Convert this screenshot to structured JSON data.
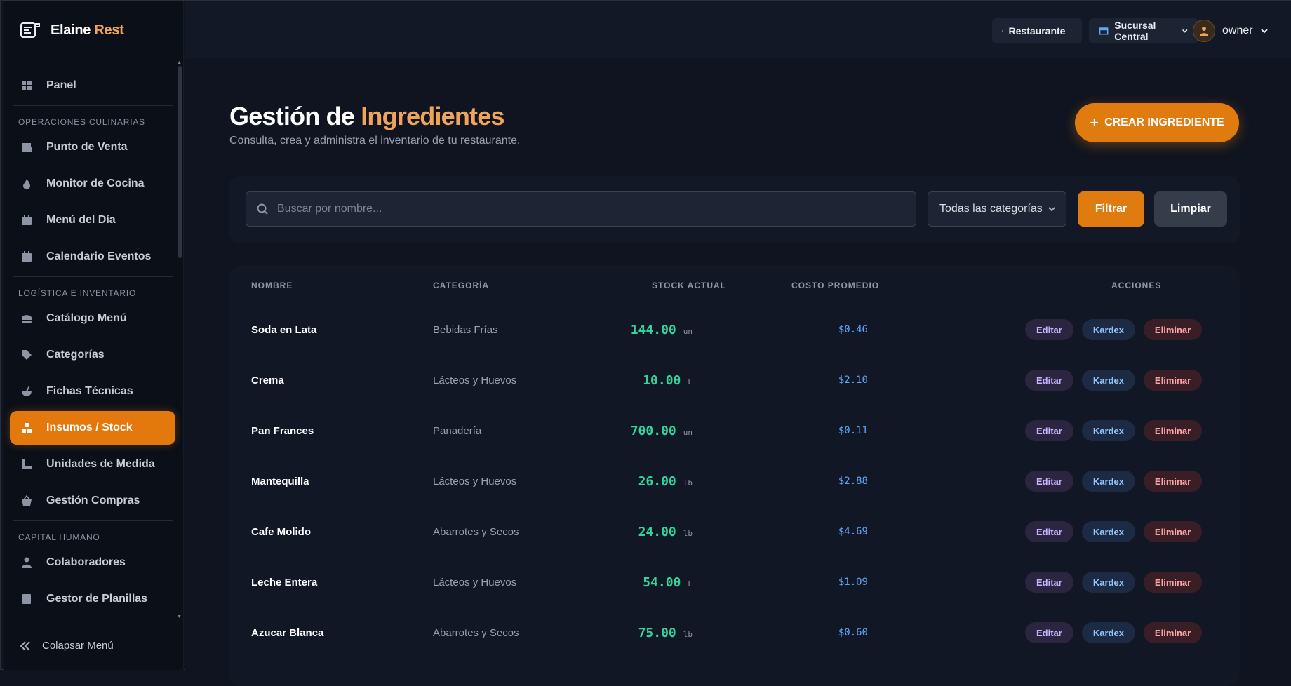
{
  "app": {
    "brand_main": "Elaine",
    "brand_accent": "Rest"
  },
  "sidebar": {
    "items": [
      {
        "label": "Panel",
        "icon": "grid-icon"
      },
      {
        "section": "OPERACIONES CULINARIAS"
      },
      {
        "label": "Punto de Venta",
        "icon": "register-icon"
      },
      {
        "label": "Monitor de Cocina",
        "icon": "flame-icon"
      },
      {
        "label": "Menú del Día",
        "icon": "calendar-day-icon"
      },
      {
        "label": "Calendario Eventos",
        "icon": "calendar-icon"
      },
      {
        "section": "LOGÍSTICA E INVENTARIO"
      },
      {
        "label": "Catálogo Menú",
        "icon": "burger-icon"
      },
      {
        "label": "Categorías",
        "icon": "tags-icon"
      },
      {
        "label": "Fichas Técnicas",
        "icon": "mortar-icon"
      },
      {
        "label": "Insumos / Stock",
        "icon": "boxes-icon",
        "active": true
      },
      {
        "label": "Unidades de Medida",
        "icon": "ruler-icon"
      },
      {
        "label": "Gestión Compras",
        "icon": "basket-icon"
      },
      {
        "section": "CAPITAL HUMANO"
      },
      {
        "label": "Colaboradores",
        "icon": "user-tie-icon"
      },
      {
        "label": "Gestor de Planillas",
        "icon": "calculator-icon"
      }
    ],
    "collapse_label": "Colapsar Menú"
  },
  "topbar": {
    "restaurant_label": "Restaurante",
    "branch_label": "Sucursal Central",
    "user_label": "owner"
  },
  "page": {
    "title_main": "Gestión de",
    "title_accent": "Ingredientes",
    "subtitle": "Consulta, crea y administra el inventario de tu restaurante.",
    "create_label": "CREAR INGREDIENTE"
  },
  "filters": {
    "search_placeholder": "Buscar por nombre...",
    "category_selected": "Todas las categorías",
    "filter_label": "Filtrar",
    "clear_label": "Limpiar"
  },
  "table": {
    "headers": [
      "NOMBRE",
      "CATEGORÍA",
      "STOCK ACTUAL",
      "COSTO PROMEDIO",
      "ACCIONES"
    ],
    "action_labels": {
      "edit": "Editar",
      "kardex": "Kardex",
      "delete": "Eliminar"
    },
    "rows": [
      {
        "name": "Soda en Lata",
        "category": "Bebidas Frías",
        "stock": "144.00",
        "unit": "un",
        "cost": "$0.46"
      },
      {
        "name": "Crema",
        "category": "Lácteos y Huevos",
        "stock": "10.00",
        "unit": "L",
        "cost": "$2.10"
      },
      {
        "name": "Pan Frances",
        "category": "Panadería",
        "stock": "700.00",
        "unit": "un",
        "cost": "$0.11"
      },
      {
        "name": "Mantequilla",
        "category": "Lácteos y Huevos",
        "stock": "26.00",
        "unit": "lb",
        "cost": "$2.88"
      },
      {
        "name": "Cafe Molido",
        "category": "Abarrotes y Secos",
        "stock": "24.00",
        "unit": "lb",
        "cost": "$4.69"
      },
      {
        "name": "Leche Entera",
        "category": "Lácteos y Huevos",
        "stock": "54.00",
        "unit": "L",
        "cost": "$1.09"
      },
      {
        "name": "Azucar Blanca",
        "category": "Abarrotes y Secos",
        "stock": "75.00",
        "unit": "lb",
        "cost": "$0.60"
      }
    ]
  },
  "colors": {
    "accent": "#e07b0f",
    "stock_green": "#34d399",
    "cost_blue": "#60a5fa"
  }
}
